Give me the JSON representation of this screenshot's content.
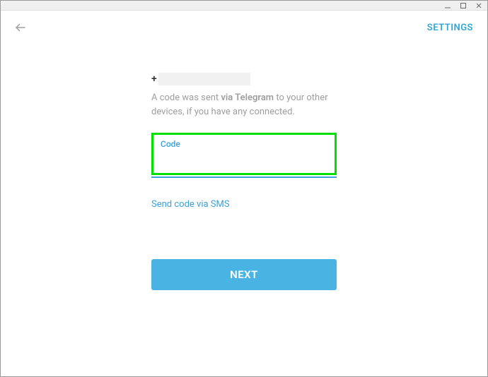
{
  "window": {
    "minimize": "—",
    "maximize": "□",
    "close": "✕"
  },
  "header": {
    "settings_label": "SETTINGS"
  },
  "phone": {
    "plus": "+",
    "masked_number": ""
  },
  "desc": {
    "text_before": "A code was sent ",
    "bold_text": "via Telegram",
    "text_after": " to your other devices, if you have any connected."
  },
  "code_field": {
    "label": "Code",
    "value": ""
  },
  "links": {
    "send_sms": "Send code via SMS"
  },
  "buttons": {
    "next": "NEXT"
  }
}
